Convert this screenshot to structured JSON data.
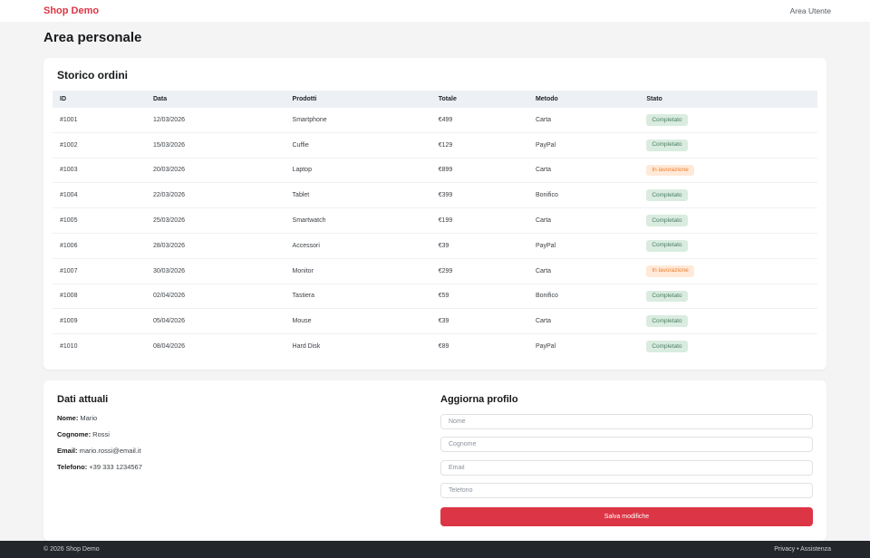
{
  "header": {
    "brand": "Shop Demo",
    "nav_link": "Area Utente"
  },
  "page_title": "Area personale",
  "orders": {
    "title": "Storico ordini",
    "columns": [
      "ID",
      "Data",
      "Prodotti",
      "Totale",
      "Metodo",
      "Stato"
    ],
    "rows": [
      {
        "id": "#1001",
        "date": "12/03/2026",
        "product": "Smartphone",
        "total": "€499",
        "method": "Carta",
        "status": "Completato",
        "status_type": "success"
      },
      {
        "id": "#1002",
        "date": "15/03/2026",
        "product": "Cuffie",
        "total": "€129",
        "method": "PayPal",
        "status": "Completato",
        "status_type": "success"
      },
      {
        "id": "#1003",
        "date": "20/03/2026",
        "product": "Laptop",
        "total": "€899",
        "method": "Carta",
        "status": "In lavorazione",
        "status_type": "warning"
      },
      {
        "id": "#1004",
        "date": "22/03/2026",
        "product": "Tablet",
        "total": "€399",
        "method": "Bonifico",
        "status": "Completato",
        "status_type": "success"
      },
      {
        "id": "#1005",
        "date": "25/03/2026",
        "product": "Smartwatch",
        "total": "€199",
        "method": "Carta",
        "status": "Completato",
        "status_type": "success"
      },
      {
        "id": "#1006",
        "date": "28/03/2026",
        "product": "Accessori",
        "total": "€39",
        "method": "PayPal",
        "status": "Completato",
        "status_type": "success"
      },
      {
        "id": "#1007",
        "date": "30/03/2026",
        "product": "Monitor",
        "total": "€299",
        "method": "Carta",
        "status": "In lavorazione",
        "status_type": "warning"
      },
      {
        "id": "#1008",
        "date": "02/04/2026",
        "product": "Tastiera",
        "total": "€59",
        "method": "Bonifico",
        "status": "Completato",
        "status_type": "success"
      },
      {
        "id": "#1009",
        "date": "05/04/2026",
        "product": "Mouse",
        "total": "€39",
        "method": "Carta",
        "status": "Completato",
        "status_type": "success"
      },
      {
        "id": "#1010",
        "date": "08/04/2026",
        "product": "Hard Disk",
        "total": "€89",
        "method": "PayPal",
        "status": "Completato",
        "status_type": "success"
      }
    ]
  },
  "profile": {
    "current": {
      "title": "Dati attuali",
      "fields": [
        {
          "label": "Nome:",
          "value": " Mario"
        },
        {
          "label": "Cognome:",
          "value": " Rossi"
        },
        {
          "label": "Email:",
          "value": " mario.rossi@email.it"
        },
        {
          "label": "Telefono:",
          "value": " +39 333 1234567"
        }
      ]
    },
    "update": {
      "title": "Aggiorna profilo",
      "placeholders": [
        "Nome",
        "Cognome",
        "Email",
        "Telefono"
      ],
      "submit_label": "Salva modifiche"
    }
  },
  "footer": {
    "copyright": "© 2026 Shop Demo",
    "links": "Privacy • Assistenza"
  },
  "colors": {
    "accent": "#dc3545",
    "badge_success_bg": "#d9ecdf",
    "badge_success_text": "#4a7d61",
    "badge_warning_bg": "#ffe9d8",
    "badge_warning_text": "#ee7c2b",
    "footer_bg": "#23272b",
    "table_header_bg": "#edf1f6"
  }
}
